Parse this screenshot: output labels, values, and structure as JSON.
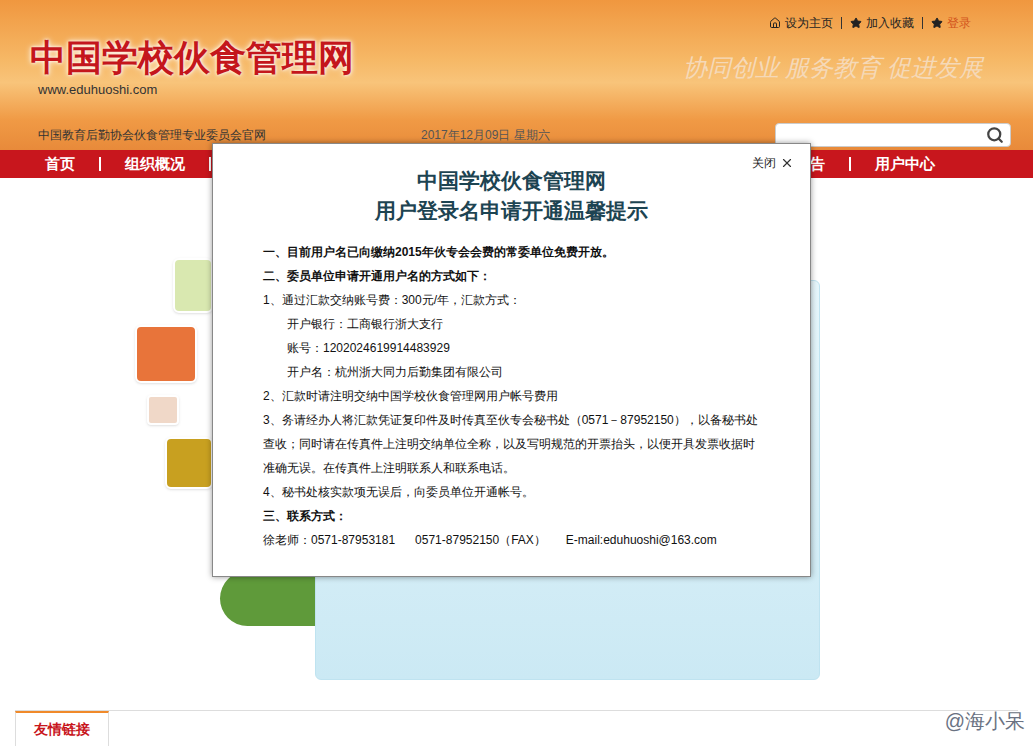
{
  "header": {
    "top_links": [
      {
        "label": "设为主页",
        "kind": "home",
        "color": "#222222"
      },
      {
        "label": "加入收藏",
        "kind": "star",
        "color": "#222222"
      },
      {
        "label": "登录",
        "kind": "star",
        "color": "#d2531c"
      }
    ],
    "logo": "中国学校伙食管理网",
    "url": "www.eduhuoshi.com",
    "slogan": "协同创业  服务教育  促进发展",
    "subtitle": "中国教育后勤协会伙食管理专业委员会官网",
    "date": "2017年12月09日 星期六"
  },
  "nav": [
    {
      "label": "首页",
      "group": "left"
    },
    {
      "label": "组织概况",
      "group": "left"
    },
    {
      "label": "报告",
      "group": "right"
    },
    {
      "label": "用户中心",
      "group": "right"
    }
  ],
  "dialog": {
    "close": "关闭",
    "title": [
      "中国学校伙食管理网",
      "用户登录名申请开通温馨提示"
    ],
    "lines": [
      {
        "kind": "heading",
        "text": "一、目前用户名已向缴纳2015年伙专会会费的常委单位免费开放。"
      },
      {
        "kind": "heading",
        "text": "二、委员单位申请开通用户名的方式如下："
      },
      {
        "kind": "item",
        "text": "1、通过汇款交纳账号费：300元/年，汇款方式："
      },
      {
        "kind": "indent",
        "text": "开户银行：工商银行浙大支行"
      },
      {
        "kind": "indent",
        "text": "账号：1202024619914483929"
      },
      {
        "kind": "indent",
        "text": "开户名：杭州浙大同力后勤集团有限公司"
      },
      {
        "kind": "item",
        "text": "2、汇款时请注明交纳中国学校伙食管理网用户帐号费用"
      },
      {
        "kind": "item",
        "text": "3、务请经办人将汇款凭证复印件及时传真至伙专会秘书处（0571－87952150），以备秘书处查收；同时请在传真件上注明交纳单位全称，以及写明规范的开票抬头，以便开具发票收据时准确无误。在传真件上注明联系人和联系电话。"
      },
      {
        "kind": "item",
        "text": "4、秘书处核实款项无误后，向委员单位开通帐号。"
      },
      {
        "kind": "heading",
        "text": "三、联系方式："
      }
    ],
    "contact": [
      "徐老师：0571-87953181",
      "0571-87952150（FAX）",
      "E-mail:eduhuoshi@163.com"
    ]
  },
  "footer": {
    "tab": "友情链接"
  },
  "watermark": "@海小呆"
}
